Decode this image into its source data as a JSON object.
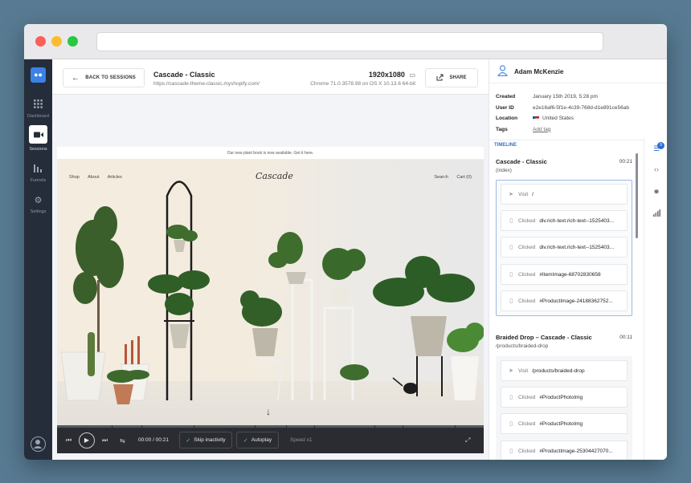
{
  "topbar": {
    "back_label": "BACK TO SESSIONS",
    "site_title": "Cascade - Classic",
    "site_url": "https://cascade-theme-classic.myshopify.com/",
    "resolution": "1920x1080",
    "browser_info": "Chrome 71.0.3578.98 on OS X 10.13.6 64-bit",
    "share_label": "SHARE"
  },
  "nav": {
    "items": [
      {
        "label": "Dashboard",
        "icon": "grid-icon"
      },
      {
        "label": "Sessions",
        "icon": "video-camera-icon"
      },
      {
        "label": "Funnels",
        "icon": "bar-chart-icon"
      },
      {
        "label": "Settings",
        "icon": "gear-icon"
      }
    ]
  },
  "site": {
    "announcement": "Our new plant book is now available. Get it here.",
    "nav": [
      "Shop",
      "About",
      "Articles"
    ],
    "logo": "Cascade",
    "right": [
      "Search",
      "Cart (0)"
    ]
  },
  "player": {
    "time": "00:00 / 00:21",
    "skip_label": "Skip inactivity",
    "autoplay_label": "Autoplay",
    "speed_label": "Speed x1"
  },
  "user": {
    "name": "Adam McKenzie",
    "meta": [
      {
        "key": "Created",
        "value": "January 15th 2019, 5:28 pm"
      },
      {
        "key": "User ID",
        "value": "e2e16af6-5f1e-4c39-768d-d1e891ce56ab"
      },
      {
        "key": "Location",
        "value": "United States"
      },
      {
        "key": "Tags",
        "value": "Add tag"
      }
    ]
  },
  "timeline": {
    "heading": "TIMELINE",
    "sections": [
      {
        "title": "Cascade - Classic",
        "time": "00:21",
        "sub": "(index)",
        "events": [
          {
            "type": "Visit",
            "value": "/"
          },
          {
            "type": "Clicked",
            "value": "div.rich-text.rich-text--1525403..."
          },
          {
            "type": "Clicked",
            "value": "div.rich-text.rich-text--1525403..."
          },
          {
            "type": "Clicked",
            "value": "#ItemImage-68702830658"
          },
          {
            "type": "Clicked",
            "value": "#ProductImage-24188362752..."
          }
        ]
      },
      {
        "title": "Braided Drop – Cascade - Classic",
        "time": "00:11",
        "sub": "/products/braided-drop",
        "events": [
          {
            "type": "Visit",
            "value": "/products/braided-drop"
          },
          {
            "type": "Clicked",
            "value": "#ProductPhotoImg"
          },
          {
            "type": "Clicked",
            "value": "#ProductPhotoImg"
          },
          {
            "type": "Clicked",
            "value": "#ProductImage-25304427070..."
          }
        ]
      }
    ],
    "badge_count": "9"
  }
}
